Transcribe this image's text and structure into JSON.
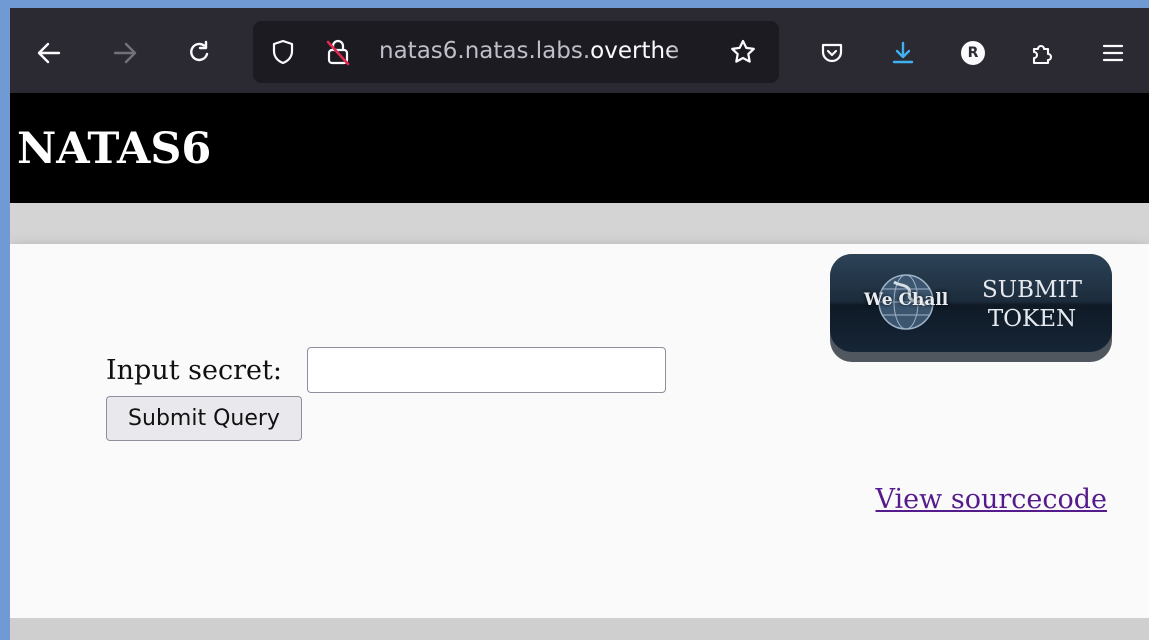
{
  "browser": {
    "url_prefix": "natas6.natas.labs.",
    "url_host": "overthe",
    "profile_initial": "R"
  },
  "page": {
    "title": "NATAS6",
    "input_label": "Input secret:",
    "input_value": "",
    "submit_label": "Submit Query",
    "source_link": "View sourcecode",
    "wechall_brand": "We Chall",
    "wechall_line1": "SUBMIT",
    "wechall_line2": "TOKEN"
  },
  "colors": {
    "toolbar": "#2b2a33",
    "urlbar": "#1c1b22",
    "banner": "#000000",
    "link_visited": "#551a8b",
    "download_accent": "#3fb0f0"
  }
}
